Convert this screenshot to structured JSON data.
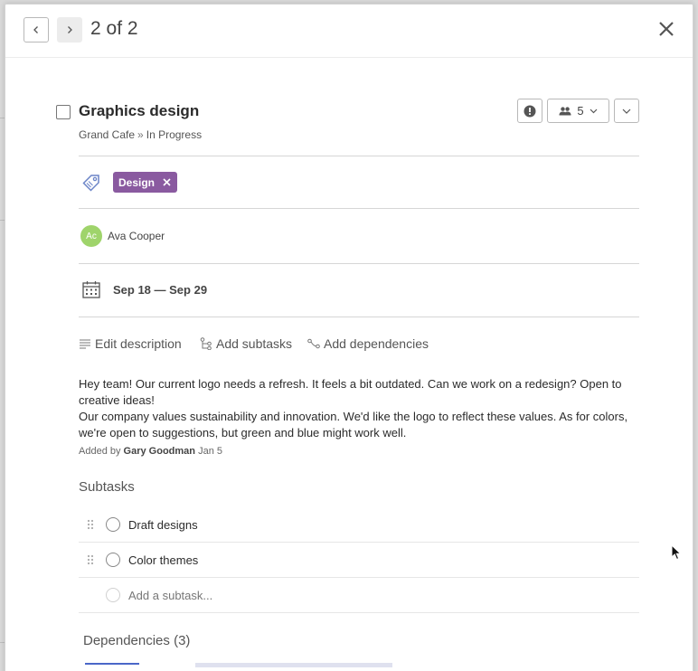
{
  "pager": {
    "text": "2 of 2"
  },
  "task": {
    "title": "Graphics design",
    "project": "Grand Cafe",
    "separator": "»",
    "status": "In Progress",
    "members_count": "5"
  },
  "tags": [
    {
      "label": "Design",
      "color": "#8a5aa0"
    }
  ],
  "assignee": {
    "initials": "Ac",
    "name": "Ava Cooper",
    "color": "#9fd46b"
  },
  "dates": {
    "range": "Sep 18 — Sep 29"
  },
  "actions": {
    "edit_description": "Edit description",
    "add_subtasks": "Add subtasks",
    "add_dependencies": "Add dependencies"
  },
  "description": {
    "line1": "Hey team! Our current logo needs a refresh. It feels a bit outdated. Can we work on a redesign? Open to creative ideas!",
    "line2": "Our company values sustainability and innovation. We'd like the logo to reflect these values. As for colors, we're open to suggestions, but green and blue might work well.",
    "added_prefix": "Added by",
    "added_by": "Gary Goodman",
    "added_date": "Jan 5"
  },
  "subtasks": {
    "title": "Subtasks",
    "items": [
      {
        "label": "Draft designs"
      },
      {
        "label": "Color themes"
      }
    ],
    "placeholder": "Add a subtask..."
  },
  "dependencies": {
    "title": "Dependencies (3)"
  }
}
